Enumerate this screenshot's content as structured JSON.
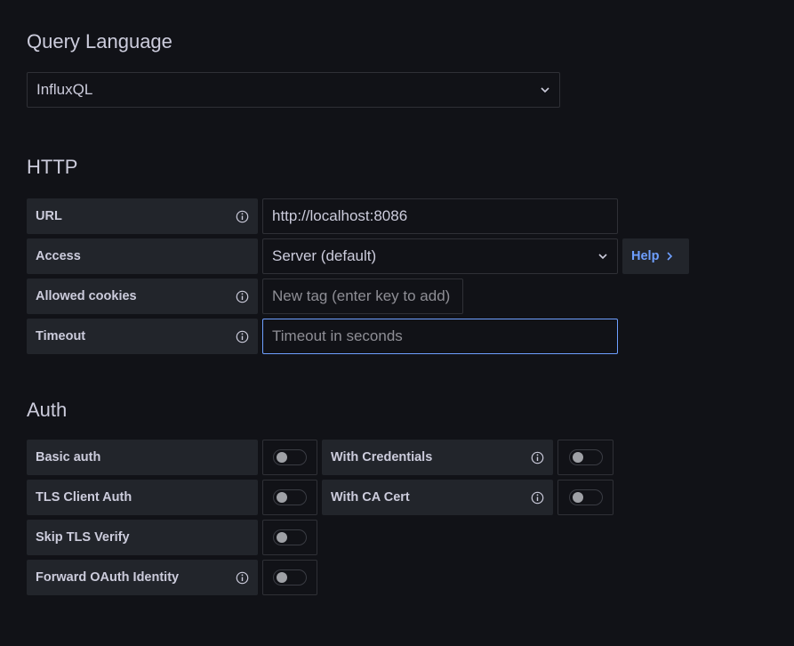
{
  "query_language": {
    "heading": "Query Language",
    "selected": "InfluxQL"
  },
  "http": {
    "heading": "HTTP",
    "url": {
      "label": "URL",
      "value": "http://localhost:8086"
    },
    "access": {
      "label": "Access",
      "selected": "Server (default)",
      "help_label": "Help"
    },
    "allowed_cookies": {
      "label": "Allowed cookies",
      "placeholder": "New tag (enter key to add)"
    },
    "timeout": {
      "label": "Timeout",
      "placeholder": "Timeout in seconds"
    }
  },
  "auth": {
    "heading": "Auth",
    "basic_auth": {
      "label": "Basic auth",
      "enabled": false
    },
    "with_credentials": {
      "label": "With Credentials",
      "enabled": false
    },
    "tls_client_auth": {
      "label": "TLS Client Auth",
      "enabled": false
    },
    "with_ca_cert": {
      "label": "With CA Cert",
      "enabled": false
    },
    "skip_tls_verify": {
      "label": "Skip TLS Verify",
      "enabled": false
    },
    "forward_oauth": {
      "label": "Forward OAuth Identity",
      "enabled": false
    }
  },
  "colors": {
    "background": "#111217",
    "label_bg": "#22252b",
    "border": "#2f3036",
    "focus_border": "#6e9fff",
    "link": "#6e9fff",
    "text": "#ccccdc"
  },
  "icons": [
    "chevron-down-icon",
    "info-icon",
    "chevron-right-icon"
  ]
}
